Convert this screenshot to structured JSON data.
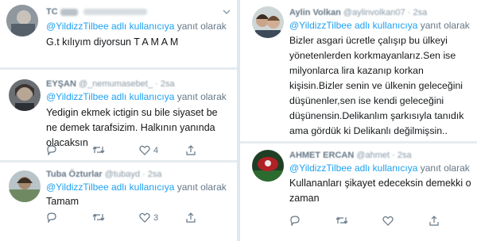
{
  "reply_prefix": "@YildizzTilbee adlı kullanıcıya",
  "reply_suffix": "yanıt olarak",
  "tweets": [
    {
      "name": "TC ",
      "handle": "",
      "text": "G.t kılıyım diyorsun   T A M A M",
      "likes": "",
      "retweets": ""
    },
    {
      "name": "EYŞAN",
      "handle": "@_nemumasebet_ · 2sa",
      "text": "Yedigin ekmek ictigin su bile siyaset be ne demek tarafsizim. Halkının yanında olacaksın",
      "likes": "4",
      "retweets": ""
    },
    {
      "name": "Tuba Özturlar",
      "handle": "@tubayd · 2sa",
      "text": "Tamam",
      "likes": "3",
      "retweets": ""
    },
    {
      "name": "Aylin Volkan",
      "handle": "@aylinvolkan07 · 2sa",
      "text": "Bizler asgari ücretle çalışıp bu ülkeyi yönetenlerden korkmayanlarız.Sen ise milyonlarca lira kazanıp korkan kişisin.Bizler senin ve ülkenin geleceğini düşünenler,sen ise kendi geleceğini düşünensin.Delikanlım şarkısıyla tanıdık ama gördük ki Delikanlı değilmişsin..",
      "likes": "",
      "retweets": ""
    },
    {
      "name": "AHMET ERCAN",
      "handle": "@ahmet · 2sa",
      "text": "Kullananları şikayet edeceksin demekki o zaman",
      "likes": "",
      "retweets": ""
    }
  ],
  "colors": {
    "link": "#1da1f2",
    "secondary": "#657786",
    "text": "#14171a",
    "divider": "#e1e8ed"
  }
}
